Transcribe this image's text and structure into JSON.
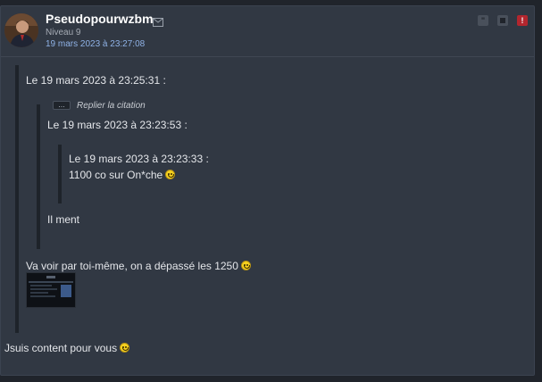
{
  "post": {
    "username": "Pseudopourwzbm",
    "level": "Niveau 9",
    "date": "19 mars 2023 à 23:27:08",
    "quote_outer_header": "Le 19 mars 2023 à 23:25:31 :",
    "reply_quote_label": "Replier la citation",
    "reply_dots": "...",
    "quote_mid_header": "Le 19 mars 2023 à 23:23:53 :",
    "quote_inner_header": "Le 19 mars 2023 à 23:23:33 :",
    "quote_inner_text": "1100 co sur On*che",
    "quote_mid_text": "Il ment",
    "quote_outer_text": "Va voir par toi-même, on a dépassé les 1250",
    "body_text": "Jsuis content pour vous"
  },
  "icons": {
    "mail": "mail-icon",
    "quote": "quote-icon",
    "profile": "profile-icon",
    "alert": "alert-icon",
    "smiley": "smiley-icon"
  },
  "colors": {
    "background": "#20242b",
    "card": "#313843",
    "date_link": "#8fb2e6",
    "alert": "#b3262e"
  }
}
